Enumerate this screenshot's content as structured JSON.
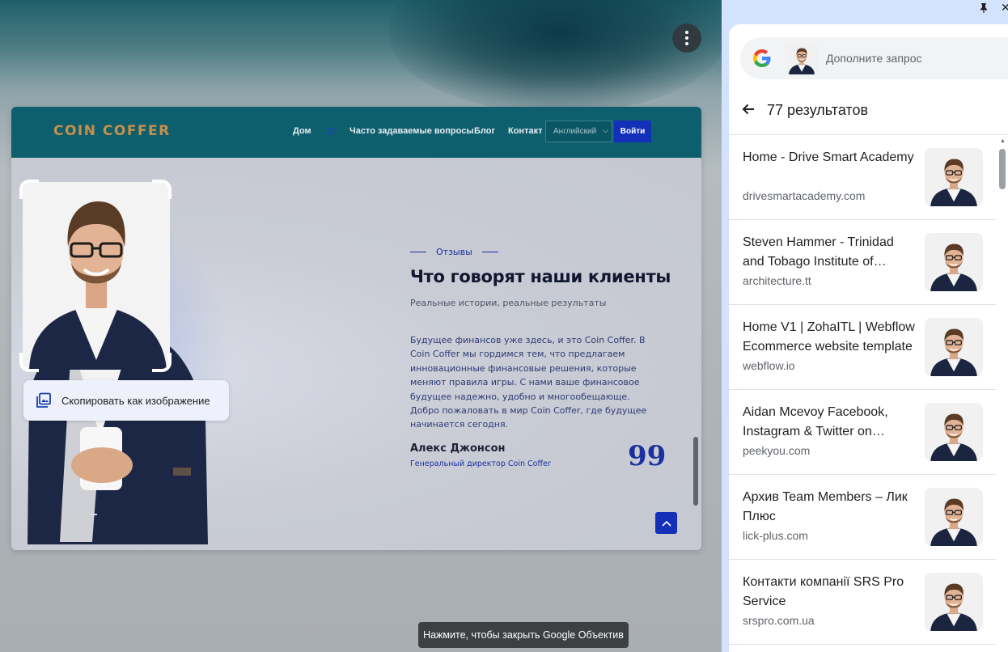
{
  "site": {
    "logo": "COIN COFFER",
    "nav": [
      "Дом",
      "Часто задаваемые вопросы",
      "Блог",
      "Контакт"
    ],
    "language": "Английский",
    "login": "Войти"
  },
  "testimonial": {
    "tag": "Отзывы",
    "title": "Что говорят наши клиенты",
    "subtitle": "Реальные истории, реальные результаты",
    "body": "Будущее финансов уже здесь, и это Coin Coffer. В Coin Coffer мы гордимся тем, что предлагаем инновационные финансовые решения, которые меняют правила игры. С нами ваше финансовое будущее надежно, удобно и многообещающе. Добро пожаловать в мир Coin Coffer, где будущее начинается сегодня.",
    "author": "Алекс Джонсон",
    "role": "Генеральный директор Coin Coffer",
    "quote_glyph": "99"
  },
  "lens": {
    "copy_action": "Скопировать как изображение",
    "toast": "Нажмите, чтобы закрыть Google Объектив"
  },
  "panel": {
    "search_placeholder": "Дополните запрос",
    "result_count": "77 результатов",
    "results": [
      {
        "title": "Home - Drive Smart Academy",
        "domain": "drivesmartacademy.com"
      },
      {
        "title": "Steven Hammer - Trinidad and Tobago Institute of Architects",
        "domain": "architecture.tt"
      },
      {
        "title": "Home V1 | ZohaITL | Webflow Ecommerce website template",
        "domain": "webflow.io"
      },
      {
        "title": "Aidan Mcevoy Facebook, Instagram & Twitter on PeekYou",
        "domain": "peekyou.com"
      },
      {
        "title": "Архив Team Members – Лик Плюс",
        "domain": "lick-plus.com"
      },
      {
        "title": "Контакти компанії SRS Pro Service",
        "domain": "srspro.com.ua"
      }
    ]
  },
  "colors": {
    "site_header": "#0e5f6e",
    "logo": "#c89048",
    "accent_blue": "#1530b8",
    "panel_bg": "#d3e3fd"
  }
}
